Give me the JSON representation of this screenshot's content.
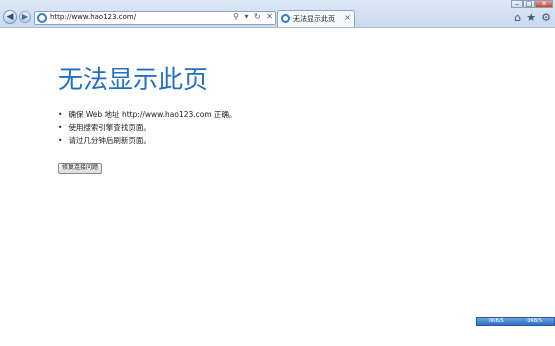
{
  "browser": {
    "url": "http://www.hao123.com/",
    "tab_title": "无法显示此页",
    "tab_close": "×",
    "back_glyph": "◀",
    "forward_glyph": "▶",
    "search_glyph": "⚲",
    "dropdown_glyph": "▾",
    "refresh_glyph": "↻",
    "stop_glyph": "✕",
    "home_glyph": "⌂",
    "favorites_glyph": "★",
    "tools_glyph": "⚙",
    "window_controls": {
      "minimize": "–",
      "maximize": "□",
      "close": "✕"
    }
  },
  "page": {
    "title": "无法显示此页",
    "bullets": [
      "确保 Web 地址 http://www.hao123.com 正确。",
      "使用搜索引擎查找页面。",
      "请过几分钟后刷新页面。"
    ],
    "bullet_glyph": "•",
    "fix_button_label": "修复连接问题"
  },
  "status": {
    "left_label": "0KB/S",
    "right_label": "0KB/S"
  },
  "colors": {
    "title": "#1f6fc4",
    "chrome_top": "#dfe9f5",
    "chrome_bottom": "#c9d9ee"
  }
}
